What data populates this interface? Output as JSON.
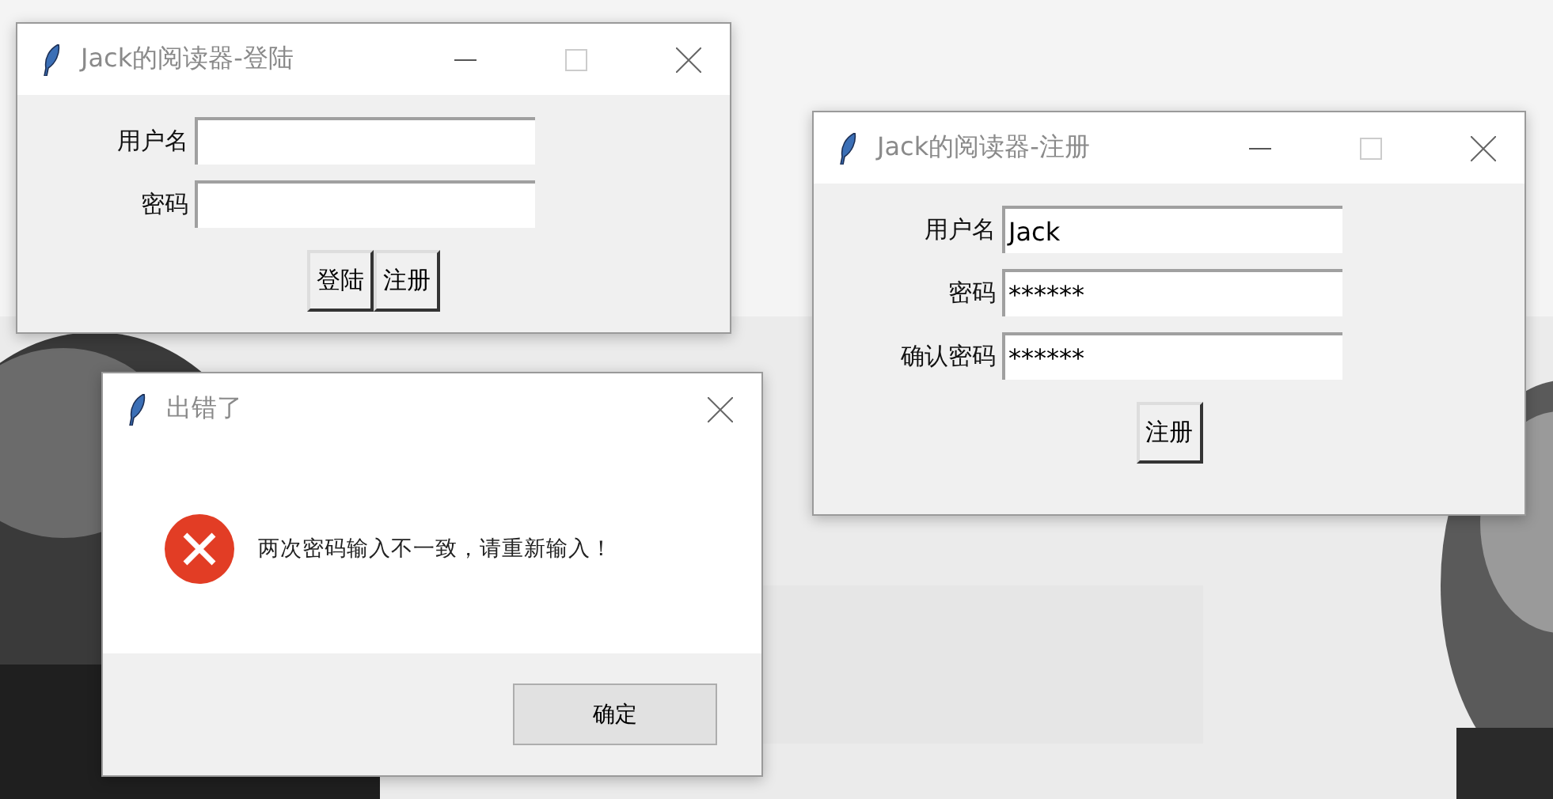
{
  "windows": [
    {
      "kind": "form",
      "title": "Jack的阅读器-登陆",
      "minimizable": true,
      "fields": [
        {
          "label": "用户名"
        },
        {
          "label": "密码"
        }
      ],
      "buttons": [
        "登陆",
        "注册"
      ]
    },
    {
      "kind": "form",
      "title": "Jack的阅读器-注册",
      "minimizable": true,
      "fields": [
        {
          "label": "用户名",
          "value": "Jack"
        },
        {
          "label": "密码",
          "value": "******"
        },
        {
          "label": "确认密码",
          "value": "******"
        }
      ],
      "buttons": [
        "注册"
      ]
    },
    {
      "kind": "message",
      "title": "出错了",
      "minimizable": false,
      "message": "两次密码输入不一致，请重新输入！",
      "buttons": [
        "确定"
      ]
    }
  ]
}
